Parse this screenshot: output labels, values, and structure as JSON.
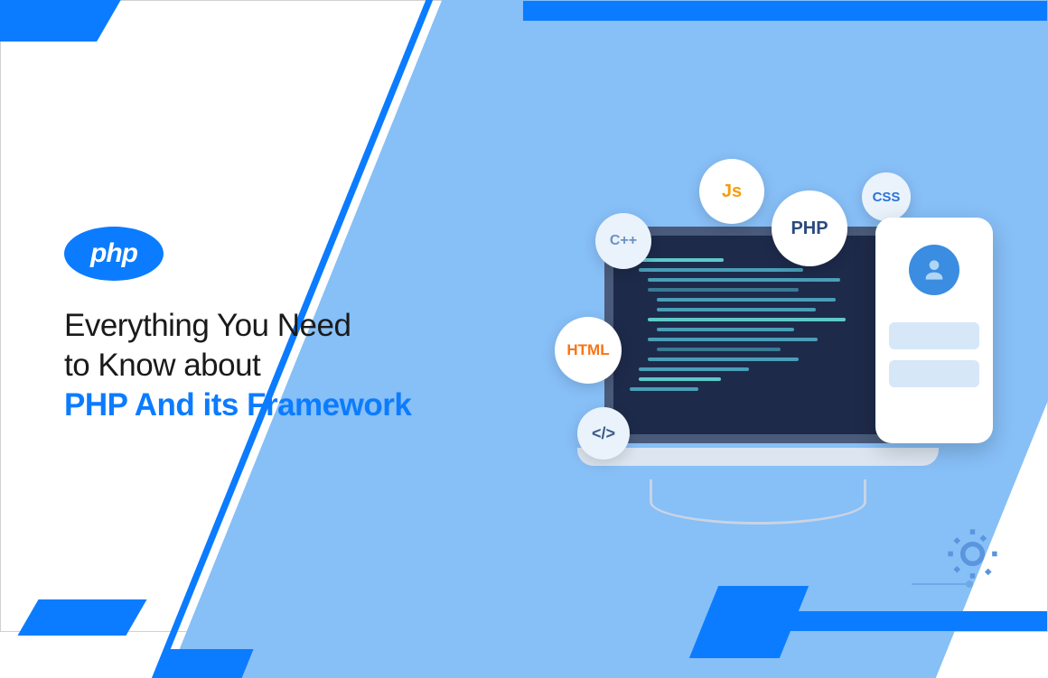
{
  "logo": {
    "text": "php"
  },
  "headline": {
    "line1": "Everything You Need",
    "line2": "to Know about",
    "accent": "PHP And its Framework"
  },
  "bubbles": {
    "js": "Js",
    "cpp": "C++",
    "php": "PHP",
    "css": "CSS",
    "html": "HTML",
    "code": "</>"
  },
  "colors": {
    "primary": "#0b7cff",
    "bg_right": "#87bff7",
    "text_dark": "#1a1a1a"
  }
}
